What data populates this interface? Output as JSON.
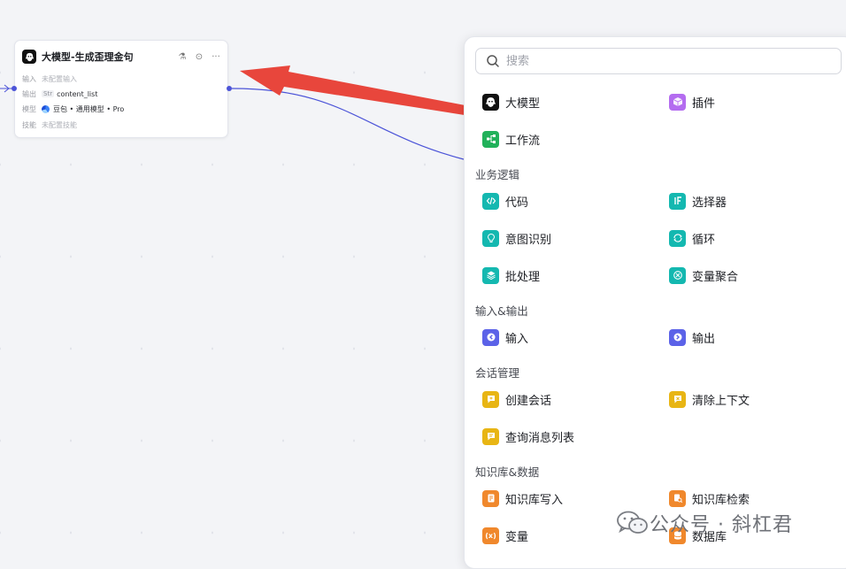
{
  "node": {
    "title": "大模型-生成歪理金句",
    "rows": [
      {
        "key": "输入",
        "value": "未配置输入"
      },
      {
        "key": "输出",
        "tag": "Str",
        "value": "content_list"
      },
      {
        "key": "模型",
        "value": "豆包 • 通用模型 • Pro"
      },
      {
        "key": "技能",
        "value": "未配置技能"
      }
    ]
  },
  "panel": {
    "search_placeholder": "搜索",
    "top_items": [
      {
        "label": "大模型",
        "icon": "llm-icon",
        "color": "#111111"
      },
      {
        "label": "插件",
        "icon": "plugin-cube-icon",
        "color": "#b46cf0"
      },
      {
        "label": "工作流",
        "icon": "workflow-icon",
        "color": "#21b15a"
      }
    ],
    "sections": [
      {
        "title": "业务逻辑",
        "items": [
          {
            "label": "代码",
            "icon": "code-icon",
            "color": "#14b8b0"
          },
          {
            "label": "选择器",
            "icon": "if-selector-icon",
            "color": "#14b8b0"
          },
          {
            "label": "意图识别",
            "icon": "intent-bulb-icon",
            "color": "#14b8b0"
          },
          {
            "label": "循环",
            "icon": "loop-icon",
            "color": "#14b8b0"
          },
          {
            "label": "批处理",
            "icon": "batch-layers-icon",
            "color": "#14b8b0"
          },
          {
            "label": "变量聚合",
            "icon": "variable-merge-icon",
            "color": "#14b8b0"
          }
        ]
      },
      {
        "title": "输入&输出",
        "items": [
          {
            "label": "输入",
            "icon": "input-arrow-icon",
            "color": "#5b62e8"
          },
          {
            "label": "输出",
            "icon": "output-arrow-icon",
            "color": "#5b62e8"
          }
        ]
      },
      {
        "title": "会话管理",
        "items": [
          {
            "label": "创建会话",
            "icon": "create-chat-icon",
            "color": "#e8b514"
          },
          {
            "label": "清除上下文",
            "icon": "clear-context-icon",
            "color": "#e8b514"
          },
          {
            "label": "查询消息列表",
            "icon": "message-list-icon",
            "color": "#e8b514"
          }
        ]
      },
      {
        "title": "知识库&数据",
        "items": [
          {
            "label": "知识库写入",
            "icon": "kb-write-icon",
            "color": "#f0882c"
          },
          {
            "label": "知识库检索",
            "icon": "kb-search-icon",
            "color": "#f0882c"
          },
          {
            "label": "变量",
            "icon": "variable-icon",
            "color": "#f0882c"
          },
          {
            "label": "数据库",
            "icon": "database-icon",
            "color": "#f0882c"
          }
        ]
      }
    ]
  },
  "watermark": {
    "text": "公众号 · 斜杠君",
    "icon": "wechat-icon"
  },
  "colors": {
    "annotation_arrow": "#e8463c",
    "connector": "#4c54d8"
  }
}
